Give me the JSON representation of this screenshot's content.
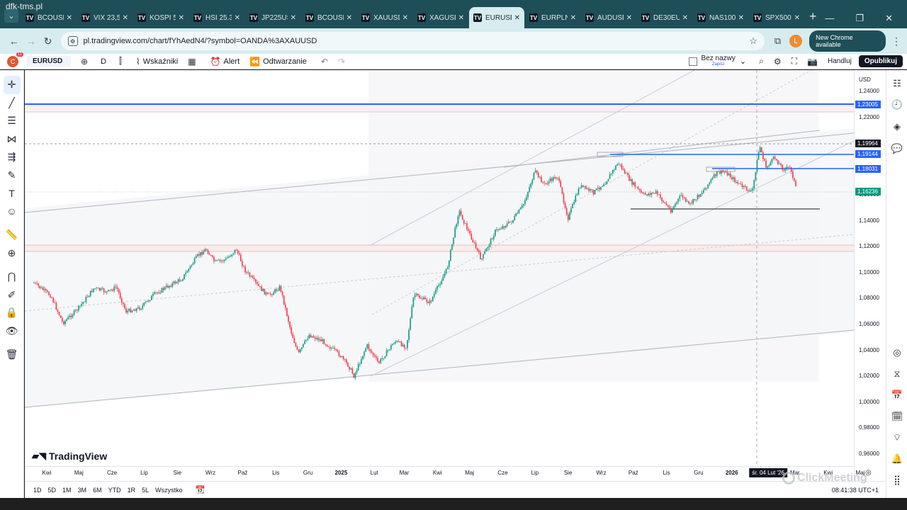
{
  "meeting": {
    "title": "dfk-tms.pl"
  },
  "browser": {
    "tabs": [
      {
        "label": "BCOUSD",
        "icon": "tradingview-favicon",
        "active": false
      },
      {
        "label": "VIX 23,5",
        "icon": "tradingview-favicon",
        "active": false
      },
      {
        "label": "KOSPI 5",
        "icon": "tradingview-favicon",
        "active": false
      },
      {
        "label": "HSI 25.3",
        "icon": "tradingview-favicon",
        "active": false
      },
      {
        "label": "JP225US",
        "icon": "tradingview-favicon",
        "active": false
      },
      {
        "label": "BCOUSD",
        "icon": "tradingview-favicon",
        "active": false
      },
      {
        "label": "XAUUSD",
        "icon": "tradingview-favicon",
        "active": false
      },
      {
        "label": "XAGUSD",
        "icon": "tradingview-favicon",
        "active": false
      },
      {
        "label": "EURUSD",
        "icon": "tradingview-favicon",
        "active": true
      },
      {
        "label": "EURPLN",
        "icon": "tradingview-favicon",
        "active": false
      },
      {
        "label": "AUDUSD",
        "icon": "tradingview-favicon",
        "active": false
      },
      {
        "label": "DE30EU",
        "icon": "tradingview-favicon",
        "active": false
      },
      {
        "label": "NAS100",
        "icon": "tradingview-favicon",
        "active": false
      },
      {
        "label": "SPX500",
        "icon": "tradingview-favicon",
        "active": false
      }
    ],
    "url": "pl.tradingview.com/chart/fYhAedN4/?symbol=OANDA%3AXAUUSD",
    "profile_initial": "L",
    "new_chrome": "New Chrome available"
  },
  "toolbar": {
    "avatar_initial": "C",
    "avatar_badge": "11",
    "symbol": "EURUSD",
    "interval": "D",
    "indicators": "Wskaźniki",
    "alert": "Alert",
    "replay": "Odtwarzanie",
    "layout_name": "Bez nazwy",
    "layout_sub": "Zapisz",
    "trade": "Handluj",
    "publish": "Opublikuj"
  },
  "bottom": {
    "ranges": [
      "1D",
      "5D",
      "1M",
      "3M",
      "6M",
      "YTD",
      "1R",
      "5L",
      "Wszystko"
    ],
    "clock": "08:41:38 UTC+1"
  },
  "watermark": "ClickMeeting",
  "tv_logo": "TradingView",
  "chart_data": {
    "type": "candlestick",
    "symbol": "EURUSD",
    "interval": "D",
    "currency": "USD",
    "y_ticks": [
      "1,24000",
      "1,22000",
      "1,20000",
      "1,18000",
      "1,16000",
      "1,14000",
      "1,12000",
      "1,10000",
      "1,08000",
      "1,06000",
      "1,04000",
      "1,02000",
      "1,00000",
      "0,98000",
      "0,96000"
    ],
    "y_tick_values": [
      1.24,
      1.22,
      1.2,
      1.18,
      1.16,
      1.14,
      1.12,
      1.1,
      1.08,
      1.06,
      1.04,
      1.02,
      1.0,
      0.98,
      0.96
    ],
    "ylim": [
      0.955,
      1.245
    ],
    "x_labels": [
      {
        "label": "Kwi",
        "date": "2024-04-01",
        "bold": false
      },
      {
        "label": "Maj",
        "date": "2024-05-01",
        "bold": false
      },
      {
        "label": "Cze",
        "date": "2024-06-01",
        "bold": false
      },
      {
        "label": "Lip",
        "date": "2024-07-01",
        "bold": false
      },
      {
        "label": "Sie",
        "date": "2024-08-01",
        "bold": false
      },
      {
        "label": "Wrz",
        "date": "2024-09-01",
        "bold": false
      },
      {
        "label": "Paź",
        "date": "2024-10-01",
        "bold": false
      },
      {
        "label": "Lis",
        "date": "2024-11-01",
        "bold": false
      },
      {
        "label": "Gru",
        "date": "2024-12-01",
        "bold": false
      },
      {
        "label": "2025",
        "date": "2025-01-01",
        "bold": true
      },
      {
        "label": "Lut",
        "date": "2025-02-01",
        "bold": false
      },
      {
        "label": "Mar",
        "date": "2025-03-01",
        "bold": false
      },
      {
        "label": "Kwi",
        "date": "2025-04-01",
        "bold": false
      },
      {
        "label": "Maj",
        "date": "2025-05-01",
        "bold": false
      },
      {
        "label": "Cze",
        "date": "2025-06-01",
        "bold": false
      },
      {
        "label": "Lip",
        "date": "2025-07-01",
        "bold": false
      },
      {
        "label": "Sie",
        "date": "2025-08-01",
        "bold": false
      },
      {
        "label": "Wrz",
        "date": "2025-09-01",
        "bold": false
      },
      {
        "label": "Paź",
        "date": "2025-10-01",
        "bold": false
      },
      {
        "label": "Lis",
        "date": "2025-11-01",
        "bold": false
      },
      {
        "label": "Gru",
        "date": "2025-12-01",
        "bold": false
      },
      {
        "label": "2026",
        "date": "2026-01-01",
        "bold": true
      },
      {
        "label": "Mar",
        "date": "2026-03-01",
        "bold": false
      },
      {
        "label": "Kwi",
        "date": "2026-04-01",
        "bold": false
      },
      {
        "label": "Maj",
        "date": "2026-05-01",
        "bold": false
      }
    ],
    "crosshair_date_label": "śr. 04 Lut '26",
    "crosshair_date": "2026-02-04",
    "price_badges": [
      {
        "label": "1,23005",
        "value": 1.23005,
        "color": "#2962ff"
      },
      {
        "label": "1,19964",
        "value": 1.19964,
        "color": "#131722"
      },
      {
        "label": "1,19144",
        "value": 1.19144,
        "color": "#2962ff"
      },
      {
        "label": "1,18031",
        "value": 1.18031,
        "color": "#2962ff"
      },
      {
        "label": "1,16236",
        "value": 1.16236,
        "color": "#089981"
      }
    ],
    "close_path": [
      [
        "2024-03-20",
        1.092
      ],
      [
        "2024-04-05",
        1.082
      ],
      [
        "2024-04-16",
        1.061
      ],
      [
        "2024-04-30",
        1.072
      ],
      [
        "2024-05-15",
        1.088
      ],
      [
        "2024-05-28",
        1.085
      ],
      [
        "2024-06-05",
        1.089
      ],
      [
        "2024-06-14",
        1.07
      ],
      [
        "2024-06-28",
        1.073
      ],
      [
        "2024-07-10",
        1.083
      ],
      [
        "2024-07-22",
        1.089
      ],
      [
        "2024-08-05",
        1.095
      ],
      [
        "2024-08-20",
        1.113
      ],
      [
        "2024-08-28",
        1.118
      ],
      [
        "2024-09-05",
        1.108
      ],
      [
        "2024-09-15",
        1.11
      ],
      [
        "2024-09-25",
        1.118
      ],
      [
        "2024-10-03",
        1.102
      ],
      [
        "2024-10-15",
        1.09
      ],
      [
        "2024-10-25",
        1.082
      ],
      [
        "2024-11-05",
        1.089
      ],
      [
        "2024-11-15",
        1.055
      ],
      [
        "2024-11-22",
        1.037
      ],
      [
        "2024-12-02",
        1.052
      ],
      [
        "2024-12-15",
        1.047
      ],
      [
        "2024-12-30",
        1.037
      ],
      [
        "2025-01-08",
        1.028
      ],
      [
        "2025-01-13",
        1.02
      ],
      [
        "2025-01-25",
        1.044
      ],
      [
        "2025-02-05",
        1.03
      ],
      [
        "2025-02-20",
        1.047
      ],
      [
        "2025-03-03",
        1.043
      ],
      [
        "2025-03-10",
        1.083
      ],
      [
        "2025-03-25",
        1.077
      ],
      [
        "2025-04-10",
        1.103
      ],
      [
        "2025-04-21",
        1.148
      ],
      [
        "2025-05-01",
        1.13
      ],
      [
        "2025-05-12",
        1.11
      ],
      [
        "2025-05-25",
        1.132
      ],
      [
        "2025-06-10",
        1.14
      ],
      [
        "2025-06-20",
        1.152
      ],
      [
        "2025-07-01",
        1.178
      ],
      [
        "2025-07-10",
        1.168
      ],
      [
        "2025-07-22",
        1.175
      ],
      [
        "2025-08-01",
        1.142
      ],
      [
        "2025-08-12",
        1.167
      ],
      [
        "2025-08-25",
        1.162
      ],
      [
        "2025-09-05",
        1.17
      ],
      [
        "2025-09-17",
        1.185
      ],
      [
        "2025-09-28",
        1.171
      ],
      [
        "2025-10-10",
        1.16
      ],
      [
        "2025-10-22",
        1.162
      ],
      [
        "2025-11-05",
        1.148
      ],
      [
        "2025-11-15",
        1.16
      ],
      [
        "2025-11-22",
        1.152
      ],
      [
        "2025-12-05",
        1.163
      ],
      [
        "2025-12-18",
        1.177
      ],
      [
        "2025-12-26",
        1.178
      ],
      [
        "2026-01-08",
        1.168
      ],
      [
        "2026-01-20",
        1.162
      ],
      [
        "2026-01-27",
        1.198
      ],
      [
        "2026-02-02",
        1.181
      ],
      [
        "2026-02-10",
        1.189
      ],
      [
        "2026-02-18",
        1.18
      ],
      [
        "2026-02-25",
        1.181
      ],
      [
        "2026-03-03",
        1.162
      ]
    ]
  }
}
